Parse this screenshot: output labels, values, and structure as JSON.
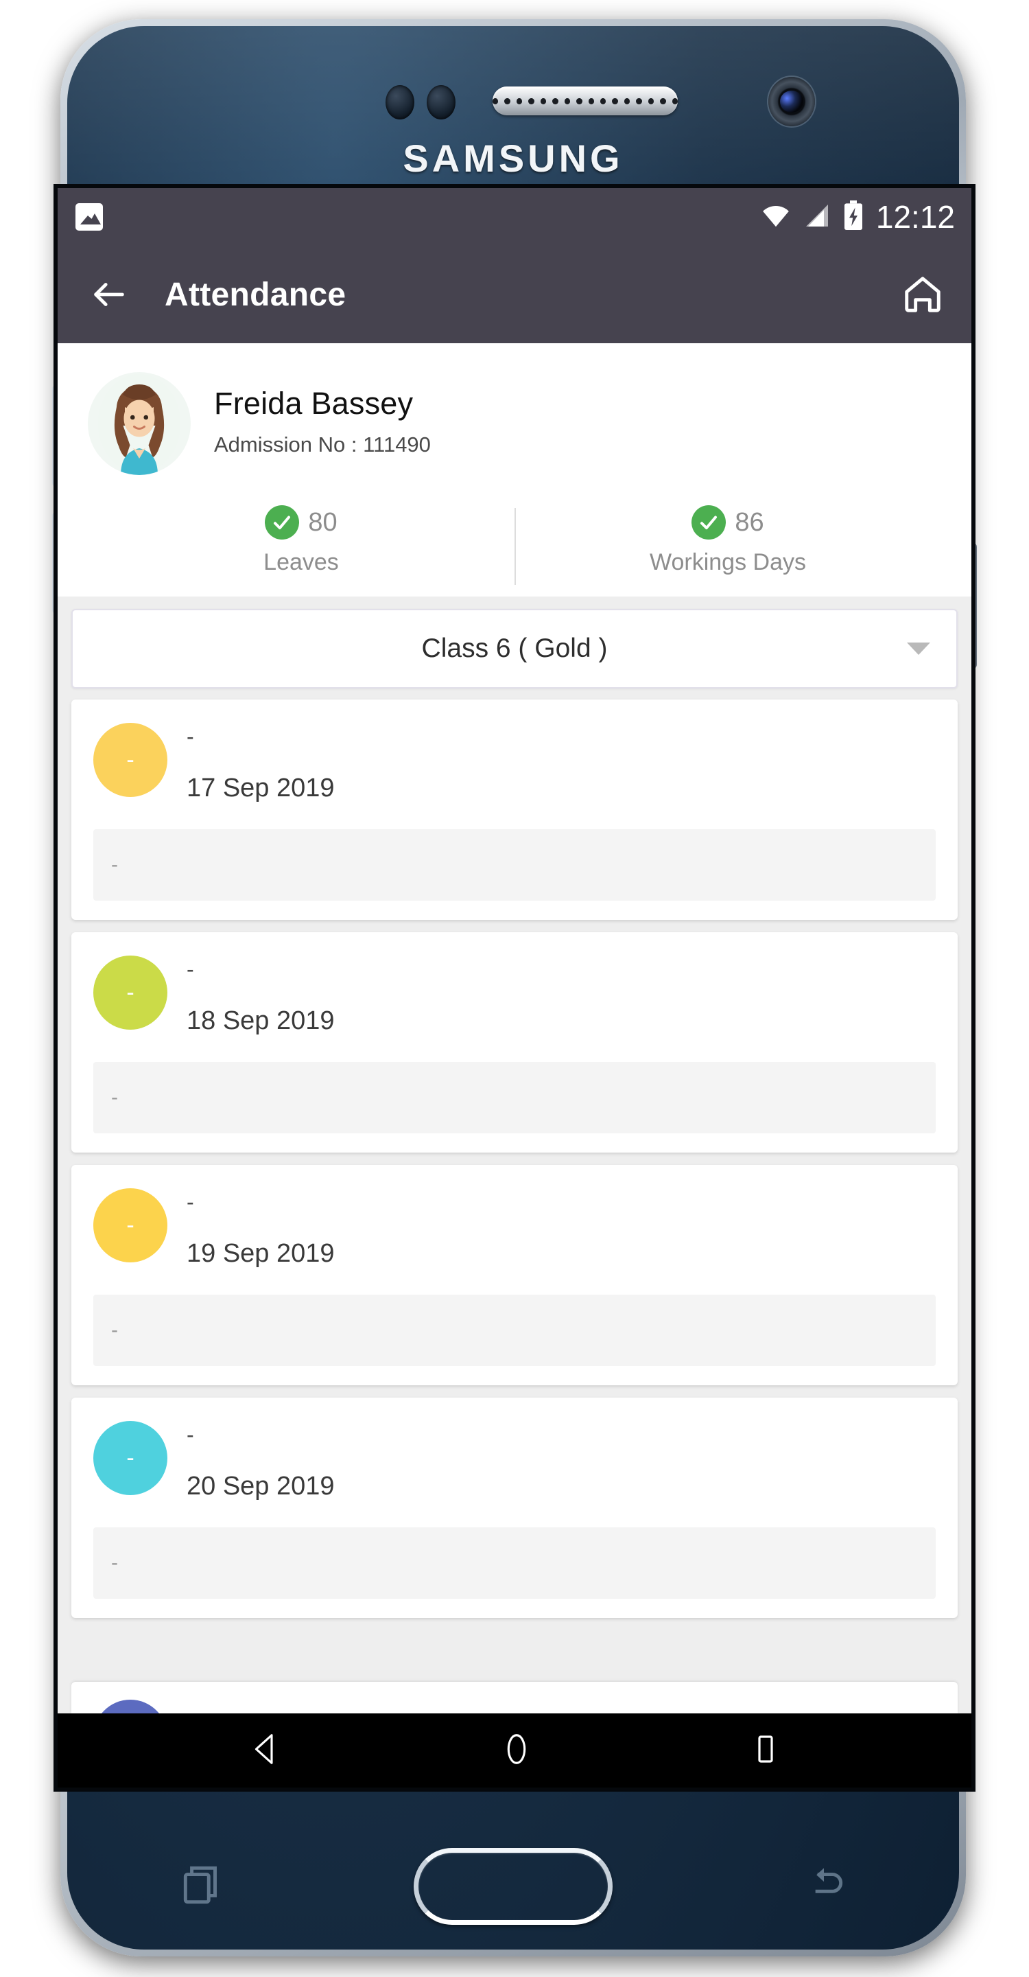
{
  "device": {
    "brand": "SAMSUNG"
  },
  "status_bar": {
    "notification_icon": "image-icon",
    "wifi_icon": "wifi-icon",
    "signal_icon": "signal-icon",
    "battery_icon": "battery-charging-icon",
    "time": "12:12"
  },
  "app_bar": {
    "back_icon": "back-arrow-icon",
    "title": "Attendance",
    "home_icon": "home-icon"
  },
  "profile": {
    "avatar": "student-avatar",
    "name": "Freida  Bassey",
    "admission": "Admission No :  111490",
    "stats": [
      {
        "icon": "check-circle-icon",
        "value": "80",
        "label": "Leaves"
      },
      {
        "icon": "check-circle-icon",
        "value": "86",
        "label": "Workings Days"
      }
    ]
  },
  "class_selector": {
    "value": "Class 6 ( Gold )",
    "caret_icon": "chevron-down-icon"
  },
  "attendance": [
    {
      "color": "#FBD25C",
      "mark": "-",
      "status": "-",
      "date": "17 Sep 2019",
      "note": "-"
    },
    {
      "color": "#CBDB48",
      "mark": "-",
      "status": "-",
      "date": "18 Sep 2019",
      "note": "-"
    },
    {
      "color": "#FCD34C",
      "mark": "-",
      "status": "-",
      "date": "19 Sep 2019",
      "note": "-"
    },
    {
      "color": "#4FD1DE",
      "mark": "-",
      "status": "-",
      "date": "20 Sep 2019",
      "note": "-"
    }
  ],
  "next_card_peek_color": "#5C6BC0",
  "nav_bar": {
    "back_icon": "triangle-back-icon",
    "home_icon": "circle-home-icon",
    "recents_icon": "square-recents-icon"
  },
  "hardware": {
    "recents_icon": "recents-hw-icon",
    "home_button": "home-hw-button",
    "back_icon": "back-hw-icon"
  },
  "theme": {
    "app_bar": "#46434F",
    "accent_green": "#4CAF50",
    "page_bg": "#EEEEEE"
  }
}
